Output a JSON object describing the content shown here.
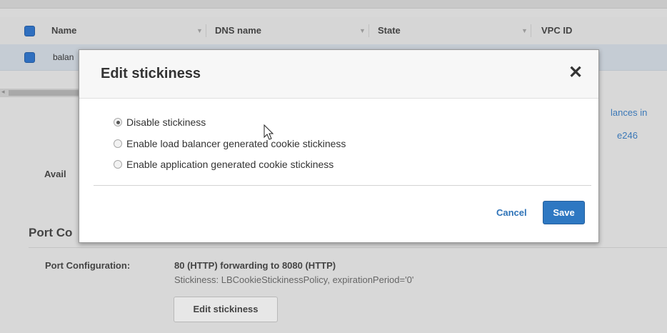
{
  "table": {
    "columns": [
      "Name",
      "DNS name",
      "State",
      "VPC ID"
    ],
    "row_name": "balan"
  },
  "background": {
    "right_fragment_1": "lances in",
    "right_fragment_2": "e246",
    "availability_label": "Avail",
    "section_title": "Port Co",
    "port_config_label": "Port Configuration:",
    "port_config_value": "80 (HTTP) forwarding to 8080 (HTTP)",
    "stickiness_text": "Stickiness: LBCookieStickinessPolicy, expirationPeriod='0'",
    "edit_stickiness_button": "Edit stickiness"
  },
  "modal": {
    "title": "Edit stickiness",
    "close_glyph": "✕",
    "options": [
      {
        "label": "Disable stickiness",
        "checked": true
      },
      {
        "label": "Enable load balancer generated cookie stickiness",
        "checked": false
      },
      {
        "label": "Enable application generated cookie stickiness",
        "checked": false
      }
    ],
    "cancel_label": "Cancel",
    "save_label": "Save"
  },
  "colors": {
    "accent": "#2e78c2",
    "link": "#2e73b8"
  }
}
